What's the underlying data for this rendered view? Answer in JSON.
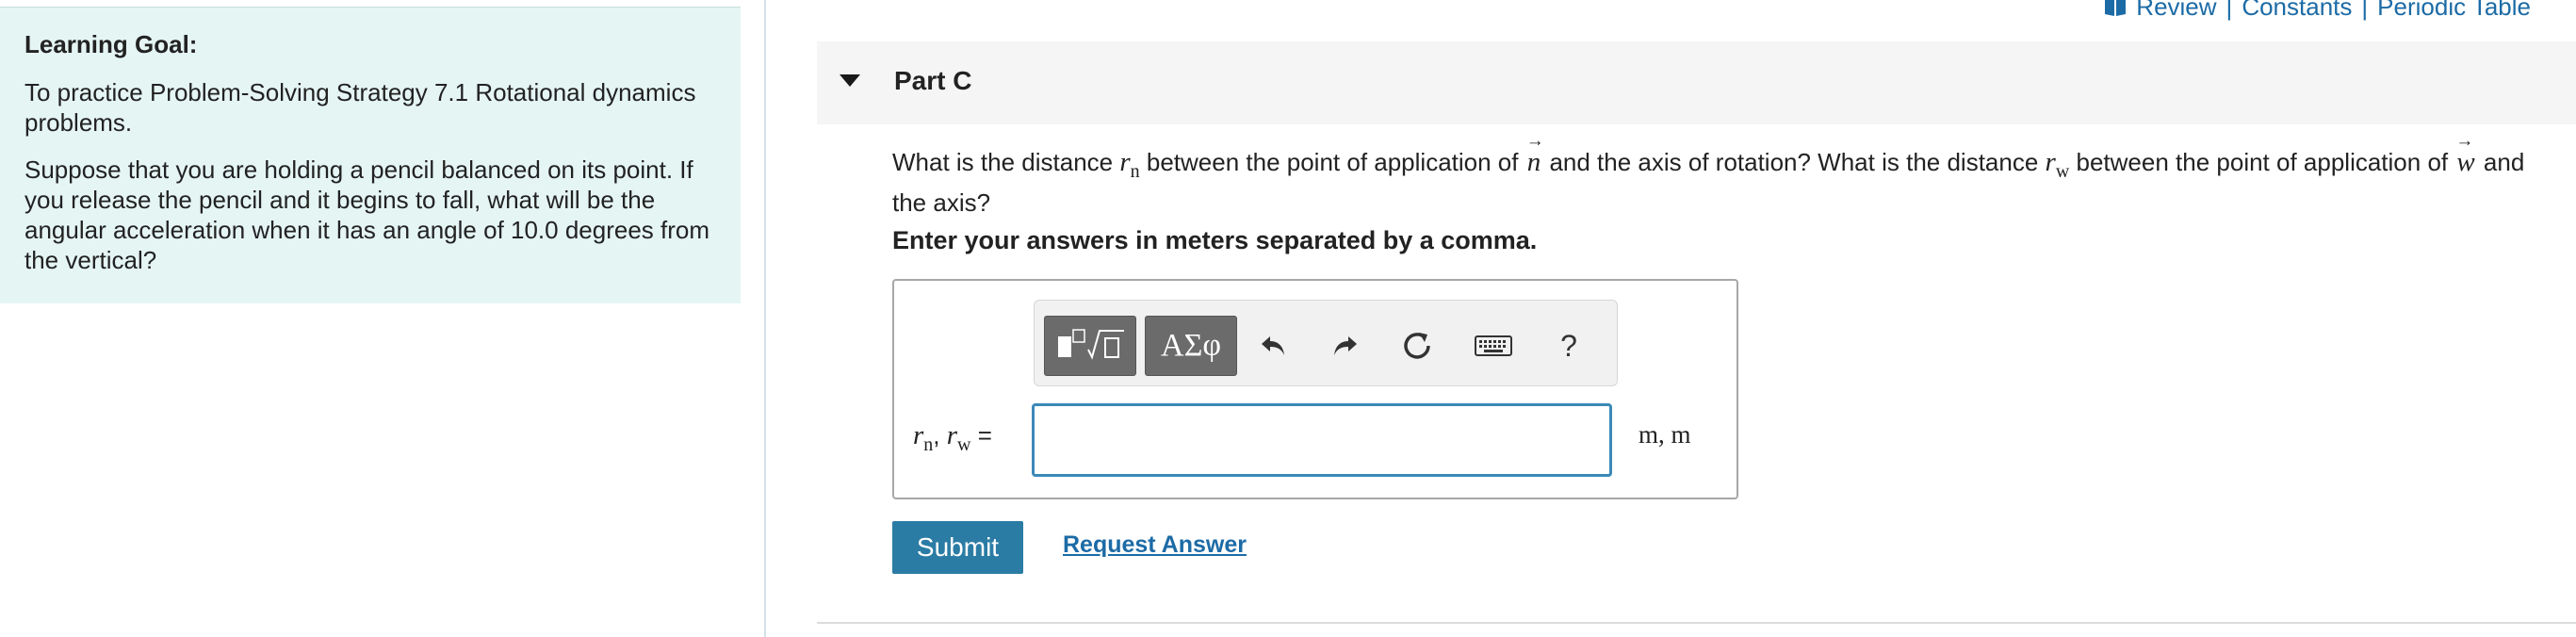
{
  "learning_goal": {
    "title": "Learning Goal:",
    "paragraph1": "To practice Problem-Solving Strategy 7.1 Rotational dynamics problems.",
    "paragraph2": "Suppose that you are holding a pencil balanced on its point. If you release the pencil and it begins to fall, what will be the angular acceleration when it has an angle of 10.0 degrees from the vertical?"
  },
  "top_links": {
    "review": "Review",
    "separator": "|",
    "constants": "Constants",
    "periodic_table": "Periodic Table",
    "color": "#1c6ba6"
  },
  "part": {
    "title": "Part C",
    "question": {
      "t1": "What is the distance ",
      "r": "r",
      "sub_n": "n",
      "t2": " between the point of application of ",
      "vec_n": "n",
      "arrow": "→",
      "t3": " and the axis of rotation? What is the distance ",
      "sub_w": "w",
      "t4": " between the point of application of ",
      "vec_w": "w",
      "t5": " and the axis?"
    },
    "instruction": "Enter your answers in meters separated by a comma."
  },
  "toolbar": {
    "greek_label": "ΑΣφ",
    "help_label": "?",
    "icons": [
      "templates-icon",
      "greek-letters-icon",
      "undo-icon",
      "redo-icon",
      "reset-icon",
      "keyboard-icon",
      "help-icon"
    ]
  },
  "answer": {
    "label_r": "r",
    "label_sub_n": "n",
    "label_comma": ", ",
    "label_sub_w": "w",
    "label_eq": " =",
    "value": "",
    "units": "m, m"
  },
  "actions": {
    "submit_label": "Submit",
    "request_answer_label": "Request Answer"
  },
  "colors": {
    "panel_bg": "#e5f5f4",
    "submit_bg": "#2b7ca5",
    "input_border": "#3b89b8",
    "link": "#1c6ba6"
  }
}
